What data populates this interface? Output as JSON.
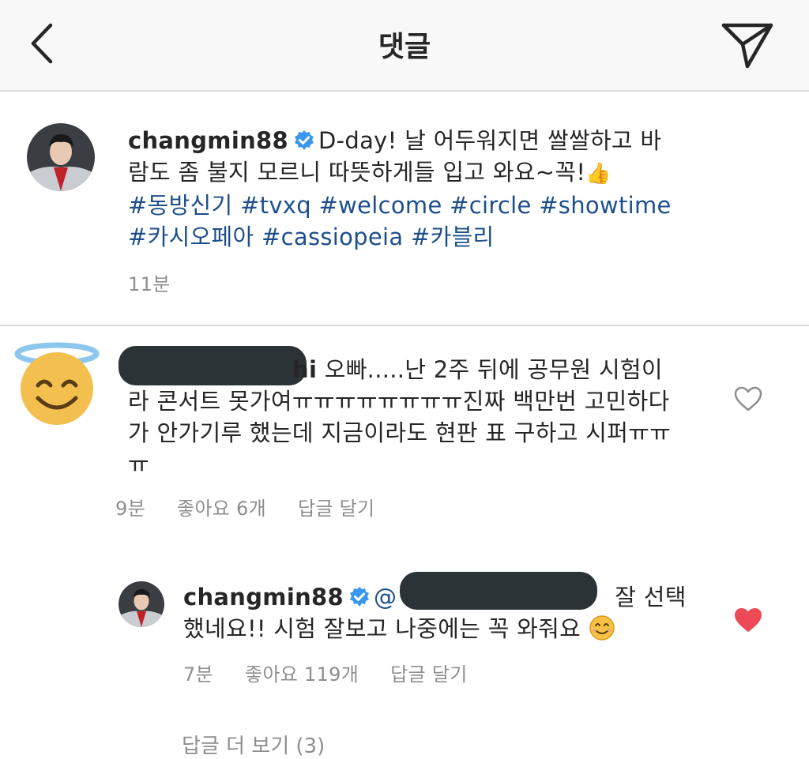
{
  "header": {
    "title": "댓글",
    "back_icon": "chevron-left-icon",
    "share_icon": "paper-plane-icon"
  },
  "caption": {
    "username": "changmin88",
    "text_line1": "D-day! 날 어두워지면 쌀쌀하고 바",
    "text_line2": "람도 좀 불지 모르니 따뜻하게들 입고 와요~꼭!",
    "emoji": "👍",
    "hashtags_line1": [
      "#동방신기",
      "#tvxq",
      "#welcome",
      "#circle",
      "#showtime"
    ],
    "hashtags_line2": [
      "#카시오페아",
      "#cassiopeia",
      "#카블리"
    ],
    "time": "11분"
  },
  "comment": {
    "username_visible_suffix": "hi",
    "text_line1": "오빠.....난 2주 뒤에 공무원 시험이",
    "text_line2": "라 콘서트 못가여ㅠㅠㅠㅠㅠㅠㅠㅠ진짜 백만번 고민하다",
    "text_line3": "가 안가기루 했는데 지금이라도 현판 표 구하고 시퍼ㅠㅠ",
    "text_line4": "ㅠ",
    "time": "9분",
    "likes": "좋아요 6개",
    "reply_label": "답글 달기",
    "liked": false
  },
  "reply": {
    "username": "changmin88",
    "mention_prefix": "@",
    "text_line1_suffix": "잘 선택",
    "text_line2": "했네요!! 시험 잘보고 나중에는 꼭 와줘요",
    "time": "7분",
    "likes": "좋아요 119개",
    "reply_label": "답글 달기",
    "liked": true
  },
  "more_replies": "답글 더 보기 (3)",
  "colors": {
    "link": "#1d4f8c",
    "meta": "#8e8e8e",
    "verified": "#3897f0",
    "heart_liked": "#ed4956"
  }
}
